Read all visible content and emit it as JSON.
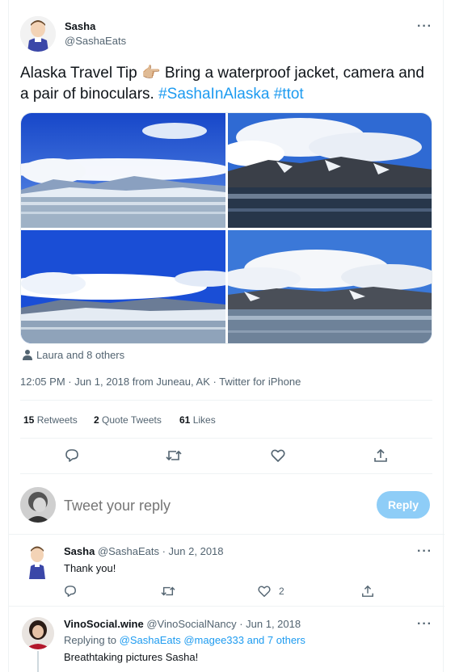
{
  "main_tweet": {
    "display_name": "Sasha",
    "handle": "@SashaEats",
    "text_plain": "Alaska Travel Tip 👉🏼 Bring a waterproof jacket, camera and a pair of binoculars.",
    "hashtag_1": "#SashaInAlaska",
    "hashtag_2": "#ttot",
    "tagged": "Laura and 8 others",
    "timestamp": "12:05 PM · Jun 1, 2018 from Juneau, AK · Twitter for iPhone",
    "stats": {
      "retweets_count": "15",
      "retweets_label": "Retweets",
      "quotes_count": "2",
      "quotes_label": "Quote Tweets",
      "likes_count": "61",
      "likes_label": "Likes"
    }
  },
  "reply_box": {
    "placeholder": "Tweet your reply",
    "button_label": "Reply"
  },
  "replies": [
    {
      "display_name": "Sasha",
      "handle_date": "@SashaEats · Jun 2, 2018",
      "text": "Thank you!",
      "like_count": "2"
    },
    {
      "display_name": "VinoSocial.wine",
      "handle_date": "@VinoSocialNancy · Jun 1, 2018",
      "replying_prefix": "Replying to",
      "replying_to": "@SashaEats @magee333 and 7 others",
      "text": "Breathtaking pictures Sasha!"
    }
  ],
  "icons": [
    "more-icon",
    "tag-person-icon",
    "reply-icon",
    "retweet-icon",
    "like-icon",
    "share-icon"
  ],
  "colors": {
    "accent": "#1d9bf0",
    "reply_button": "#8ecdf7",
    "muted": "#536471",
    "divider": "#eff3f4"
  }
}
